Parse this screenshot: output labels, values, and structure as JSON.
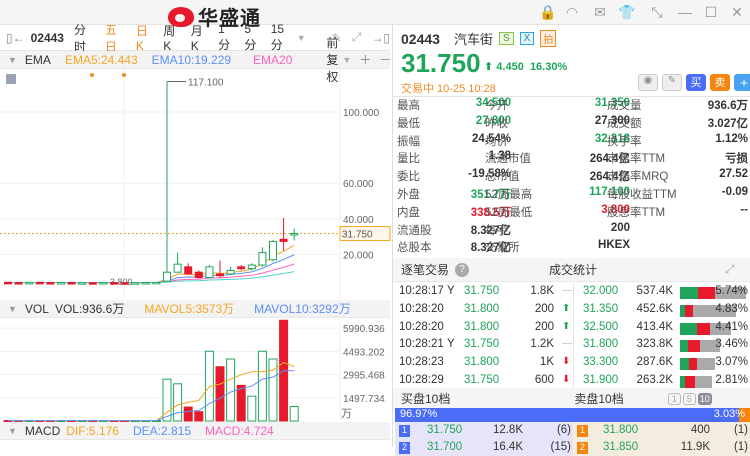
{
  "app": {
    "logo_text": "华盛通"
  },
  "toolbar": {
    "code": "02443",
    "periods": [
      "分时",
      "五日",
      "日K",
      "周K",
      "月K",
      "1分",
      "5分",
      "15分"
    ],
    "active": [
      "五日",
      "日K"
    ]
  },
  "ema": {
    "name": "EMA",
    "ema5": "EMA5:24.443",
    "ema10": "EMA10:19.229",
    "ema20": "EMA20",
    "adjust": "前复权"
  },
  "vol": {
    "name": "VOL",
    "vol": "VOL:936.6万",
    "mavol5": "MAVOL5:3573万",
    "mavol10": "MAVOL10:3292万",
    "unit": "万"
  },
  "macd": {
    "name": "MACD",
    "dif": "DIF:5.176",
    "dea": "DEA:2.815",
    "macd": "MACD:4.724"
  },
  "colors": {
    "up": "#1fa55a",
    "down": "#e8192c",
    "ema5": "#f5a623",
    "ema10": "#5b8ff9",
    "ema20": "#ff5fc0",
    "accent": "#4a6cf7"
  },
  "chart_data": [
    {
      "type": "candlestick",
      "title": "EMA",
      "price_axis": [
        "117.100",
        "100.000",
        "60.000",
        "40.000",
        "20.000"
      ],
      "last_price": "31.750",
      "low_label": "3.800",
      "ylim": [
        0,
        120
      ],
      "ohlc": [
        [
          4.3,
          4.2,
          4.5,
          4.0
        ],
        [
          4.2,
          4.1,
          4.4,
          3.9
        ],
        [
          4.1,
          4.3,
          4.5,
          4.0
        ],
        [
          4.3,
          4.2,
          4.4,
          4.0
        ],
        [
          4.2,
          4.1,
          4.3,
          3.9
        ],
        [
          4.1,
          4.2,
          4.4,
          4.0
        ],
        [
          4.2,
          4.0,
          4.3,
          3.9
        ],
        [
          4.0,
          4.1,
          4.2,
          3.9
        ],
        [
          4.1,
          4.0,
          4.2,
          3.8
        ],
        [
          4.0,
          4.2,
          4.3,
          3.9
        ],
        [
          4.2,
          4.1,
          4.3,
          4.0
        ],
        [
          4.1,
          4.0,
          4.2,
          3.8
        ],
        [
          4.0,
          4.1,
          4.3,
          3.9
        ],
        [
          4.1,
          4.2,
          4.3,
          4.0
        ],
        [
          4.2,
          4.3,
          4.5,
          4.1
        ],
        [
          5.0,
          10.0,
          117.1,
          4.8
        ],
        [
          10.0,
          14.5,
          21.0,
          10.0
        ],
        [
          13.0,
          9.0,
          15.0,
          8.5
        ],
        [
          10.0,
          7.0,
          11.0,
          6.5
        ],
        [
          7.0,
          13.0,
          14.0,
          6.5
        ],
        [
          9.0,
          8.0,
          16.5,
          7.0
        ],
        [
          9.0,
          11.0,
          13.0,
          8.5
        ],
        [
          13.0,
          12.0,
          14.0,
          11.0
        ],
        [
          12.0,
          14.0,
          15.0,
          11.0
        ],
        [
          14.0,
          21.0,
          24.0,
          13.0
        ],
        [
          17.0,
          27.3,
          28.0,
          16.0
        ],
        [
          28.5,
          27.3,
          40.5,
          22.0
        ],
        [
          31.35,
          31.75,
          34.5,
          27.8
        ]
      ]
    },
    {
      "type": "bar",
      "title": "VOL",
      "axis": [
        "5990.936",
        "4493.202",
        "2995.468",
        "1497.734"
      ],
      "ylim": [
        0,
        6600
      ],
      "values": [
        30,
        20,
        25,
        20,
        15,
        25,
        20,
        25,
        30,
        35,
        20,
        20,
        25,
        20,
        30,
        2700,
        2400,
        900,
        600,
        4500,
        3500,
        4000,
        2300,
        1600,
        4500,
        4000,
        6500,
        936.6
      ]
    }
  ],
  "quote": {
    "code": "02443",
    "name": "汽车街",
    "price": "31.750",
    "change": "4.450",
    "pct": "16.30%",
    "status": "交易中 10-25 10:28",
    "badges": [
      "S",
      "X",
      "拍"
    ],
    "buy": "买",
    "sell": "卖",
    "stats": [
      [
        [
          "最高",
          "34.500",
          "g"
        ],
        [
          "今开",
          "31.350",
          "g"
        ],
        [
          "成交量",
          "936.6万",
          ""
        ]
      ],
      [
        [
          "最低",
          "27.800",
          "g"
        ],
        [
          "昨收",
          "27.300",
          ""
        ],
        [
          "成交额",
          "3.027亿",
          ""
        ]
      ],
      [
        [
          "振幅",
          "24.54%",
          ""
        ],
        [
          "均价",
          "32.318",
          "g"
        ],
        [
          "换手率",
          "1.12%",
          ""
        ]
      ],
      [
        [
          "量比",
          "1.38",
          ""
        ],
        [
          "流通市值",
          "264.4亿",
          ""
        ],
        [
          "市盈率TTM",
          "亏损",
          ""
        ]
      ],
      [
        [
          "委比",
          "-19.58%",
          ""
        ],
        [
          "总市值",
          "264.4亿",
          ""
        ],
        [
          "市净率MRQ",
          "27.52",
          ""
        ]
      ],
      [
        [
          "外盘",
          "351.7万",
          "g"
        ],
        [
          "52周最高",
          "117.100",
          "g"
        ],
        [
          "每股收益TTM",
          "-0.09",
          ""
        ]
      ],
      [
        [
          "内盘",
          "338.5万",
          "r"
        ],
        [
          "52周最低",
          "3.800",
          "r"
        ],
        [
          "股息率TTM",
          "--",
          ""
        ]
      ],
      [
        [
          "流通股",
          "8.327亿",
          ""
        ],
        [
          "每手",
          "200",
          ""
        ],
        [
          "",
          "",
          " "
        ]
      ],
      [
        [
          "总股本",
          "8.327亿",
          ""
        ],
        [
          "交易所",
          "HKEX",
          ""
        ],
        [
          "",
          "",
          " "
        ]
      ]
    ]
  },
  "ticks": {
    "title": "逐笔交易",
    "rows": [
      [
        "10:28:17",
        "Y",
        "31.750",
        "1.8K",
        "flat"
      ],
      [
        "10:28:20",
        "",
        "31.800",
        "200",
        "up"
      ],
      [
        "10:28:20",
        "",
        "31.800",
        "200",
        "up"
      ],
      [
        "10:28:21",
        "Y",
        "31.750",
        "1.2K",
        "flat"
      ],
      [
        "10:28:23",
        "",
        "31.800",
        "1K",
        "down"
      ],
      [
        "10:28:29",
        "",
        "31.750",
        "600",
        "down"
      ]
    ]
  },
  "stats_panel": {
    "title": "成交统计",
    "rows": [
      [
        "32.000",
        "537.4K",
        "5.74%",
        0.28,
        0.25
      ],
      [
        "31.350",
        "452.6K",
        "4.83%",
        0.08,
        0.12
      ],
      [
        "32.500",
        "413.4K",
        "4.41%",
        0.25,
        0.2
      ],
      [
        "31.800",
        "323.8K",
        "3.46%",
        0.12,
        0.18
      ],
      [
        "33.300",
        "287.6K",
        "3.07%",
        0.14,
        0.12
      ],
      [
        "31.900",
        "263.2K",
        "2.81%",
        0.08,
        0.14
      ]
    ]
  },
  "orderbook": {
    "bid_title": "买盘10档",
    "ask_title": "卖盘10档",
    "levels": [
      "1",
      "5",
      "10"
    ],
    "bid_pct": "96.97%",
    "ask_pct": "3.03%",
    "bid_frac": 0.9697,
    "bids": [
      [
        "1",
        "31.750",
        "12.8K",
        "(6)"
      ],
      [
        "2",
        "31.700",
        "16.4K",
        "(15)"
      ]
    ],
    "asks": [
      [
        "1",
        "31.800",
        "400",
        "(1)"
      ],
      [
        "2",
        "31.850",
        "11.9K",
        "(1)"
      ]
    ]
  }
}
